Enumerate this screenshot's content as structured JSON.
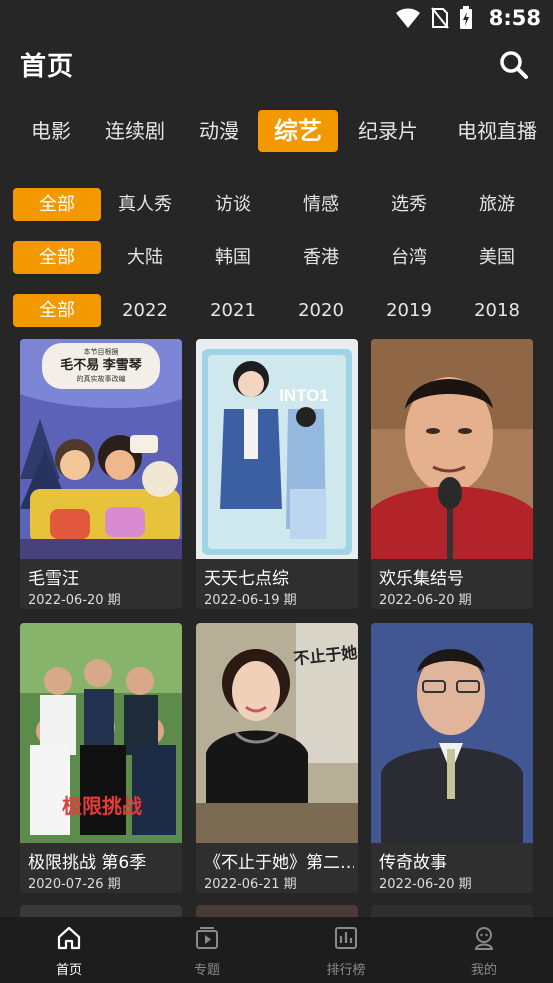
{
  "status": {
    "time": "8:58"
  },
  "header": {
    "title": "首页"
  },
  "tabs": [
    {
      "label": "电影"
    },
    {
      "label": "连续剧"
    },
    {
      "label": "动漫"
    },
    {
      "label": "综艺"
    },
    {
      "label": "纪录片"
    },
    {
      "label": "电视直播"
    }
  ],
  "filters": {
    "type": [
      "全部",
      "真人秀",
      "访谈",
      "情感",
      "选秀",
      "旅游"
    ],
    "region": [
      "全部",
      "大陆",
      "韩国",
      "香港",
      "台湾",
      "美国"
    ],
    "year": [
      "全部",
      "2022",
      "2021",
      "2020",
      "2019",
      "2018"
    ]
  },
  "cards": [
    {
      "title": "毛雪汪",
      "date": "2022-06-20 期",
      "poster_text": "本节目根据\n毛不易 李雪琴\n的真实故事改编"
    },
    {
      "title": "天天七点综",
      "date": "2022-06-19 期",
      "poster_text": "INTO1"
    },
    {
      "title": "欢乐集结号",
      "date": "2022-06-20 期"
    },
    {
      "title": "极限挑战 第6季",
      "date": "2020-07-26 期",
      "poster_text": "极限挑战"
    },
    {
      "title": "《不止于她》第二…",
      "date": "2022-06-21 期",
      "poster_text": "不止于她"
    },
    {
      "title": "传奇故事",
      "date": "2022-06-20 期"
    }
  ],
  "bottom_nav": [
    {
      "label": "首页",
      "icon": "home-icon"
    },
    {
      "label": "专题",
      "icon": "topic-icon"
    },
    {
      "label": "排行榜",
      "icon": "ranking-icon"
    },
    {
      "label": "我的",
      "icon": "profile-icon"
    }
  ],
  "colors": {
    "accent": "#f39800",
    "background": "#262626",
    "nav": "#1d1d1d"
  }
}
